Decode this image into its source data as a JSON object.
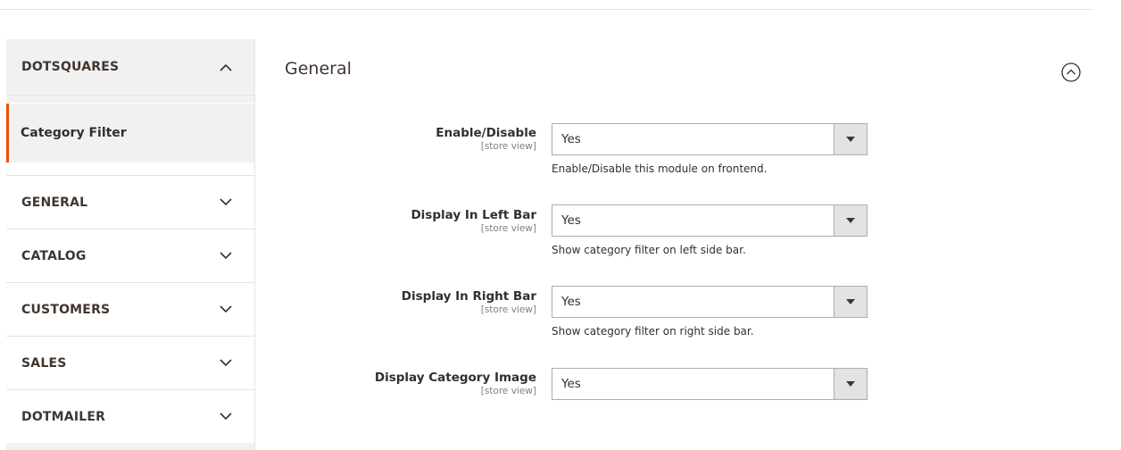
{
  "sidebar": {
    "group_title": "DOTSQUARES",
    "active_item": "Category Filter",
    "items": [
      "GENERAL",
      "CATALOG",
      "CUSTOMERS",
      "SALES",
      "DOTMAILER"
    ]
  },
  "section": {
    "title": "General"
  },
  "fields": [
    {
      "label": "Enable/Disable",
      "scope": "[store view]",
      "value": "Yes",
      "note": "Enable/Disable this module on frontend."
    },
    {
      "label": "Display In Left Bar",
      "scope": "[store view]",
      "value": "Yes",
      "note": "Show category filter on left side bar."
    },
    {
      "label": "Display In Right Bar",
      "scope": "[store view]",
      "value": "Yes",
      "note": "Show category filter on right side bar."
    },
    {
      "label": "Display Category Image",
      "scope": "[store view]",
      "value": "Yes"
    }
  ],
  "colors": {
    "accent": "#eb5202",
    "sidebar_bg": "#f1f1f1"
  }
}
